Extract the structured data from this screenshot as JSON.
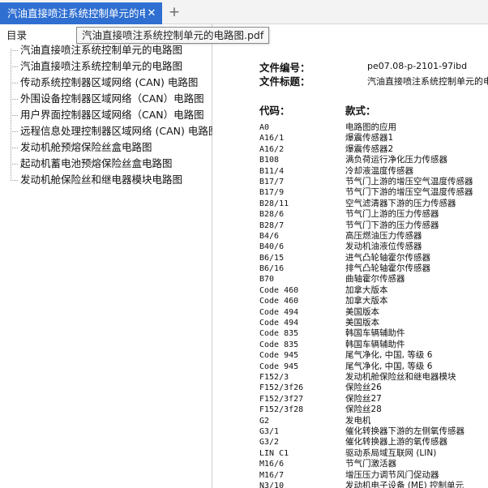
{
  "tabbar": {
    "active_tab": "汽油直接喷注系统控制单元的电路图.pdf",
    "close_icon": "close-icon",
    "new_tab_icon": "plus-icon"
  },
  "tooltip": "汽油直接喷注系统控制单元的电路图.pdf",
  "sidebar": {
    "title": "目录",
    "items": [
      "汽油直接喷注系统控制单元的电路图",
      "汽油直接喷注系统控制单元的电路图",
      "传动系统控制器区域网络 (CAN) 电路图",
      "外围设备控制器区域网络（CAN）电路图",
      "用户界面控制器区域网络（CAN）电路图",
      "远程信息处理控制器区域网络 (CAN) 电路图",
      "发动机舱预熔保险丝盒电路图",
      "起动机蓄电池预熔保险丝盒电路图",
      "发动机舱保险丝和继电器模块电路图"
    ]
  },
  "document": {
    "doc_number_label": "文件编号：",
    "doc_number": "pe07.08-p-2101-97ibd",
    "doc_title_label": "文件标题：",
    "doc_title": "汽油直接喷注系统控制单元的电",
    "code_header": "代码：",
    "desc_header": "款式：",
    "rows": [
      {
        "code": "A0",
        "desc": "电路图的应用"
      },
      {
        "code": "A16/1",
        "desc": "爆震传感器1"
      },
      {
        "code": "A16/2",
        "desc": "爆震传感器2"
      },
      {
        "code": "B108",
        "desc": "满负荷运行净化压力传感器"
      },
      {
        "code": "B11/4",
        "desc": "冷却液温度传感器"
      },
      {
        "code": "B17/7",
        "desc": "节气门上游的增压空气温度传感器"
      },
      {
        "code": "B17/9",
        "desc": "节气门下游的增压空气温度传感器"
      },
      {
        "code": "B28/11",
        "desc": "空气滤清器下游的压力传感器"
      },
      {
        "code": "B28/6",
        "desc": "节气门上游的压力传感器"
      },
      {
        "code": "B28/7",
        "desc": "节气门下游的压力传感器"
      },
      {
        "code": "B4/6",
        "desc": "高压燃油压力传感器"
      },
      {
        "code": "B40/6",
        "desc": "发动机油液位传感器"
      },
      {
        "code": "B6/15",
        "desc": "进气凸轮轴霍尔传感器"
      },
      {
        "code": "B6/16",
        "desc": "排气凸轮轴霍尔传感器"
      },
      {
        "code": "B70",
        "desc": "曲轴霍尔传感器"
      },
      {
        "code": "Code 460",
        "desc": "加拿大版本"
      },
      {
        "code": "Code 460",
        "desc": "加拿大版本"
      },
      {
        "code": "Code 494",
        "desc": "美国版本"
      },
      {
        "code": "Code 494",
        "desc": "美国版本"
      },
      {
        "code": "Code 835",
        "desc": "韩国车辆辅助件"
      },
      {
        "code": "Code 835",
        "desc": "韩国车辆辅助件"
      },
      {
        "code": "Code 945",
        "desc": "尾气净化, 中国, 等级 6"
      },
      {
        "code": "Code 945",
        "desc": "尾气净化, 中国, 等级 6"
      },
      {
        "code": "F152/3",
        "desc": "发动机舱保险丝和继电器模块"
      },
      {
        "code": "F152/3f26",
        "desc": "保险丝26"
      },
      {
        "code": "F152/3f27",
        "desc": "保险丝27"
      },
      {
        "code": "F152/3f28",
        "desc": "保险丝28"
      },
      {
        "code": "G2",
        "desc": "发电机"
      },
      {
        "code": "G3/1",
        "desc": "催化转换器下游的左侧氧传感器"
      },
      {
        "code": "G3/2",
        "desc": "催化转换器上游的氧传感器"
      },
      {
        "code": "LIN C1",
        "desc": "驱动系局域互联网 (LIN)"
      },
      {
        "code": "M16/6",
        "desc": "节气门激活器"
      },
      {
        "code": "M16/7",
        "desc": "增压压力调节风门促动器"
      },
      {
        "code": "N3/10",
        "desc": "发动机电子设备 (ME) 控制单元"
      }
    ]
  }
}
